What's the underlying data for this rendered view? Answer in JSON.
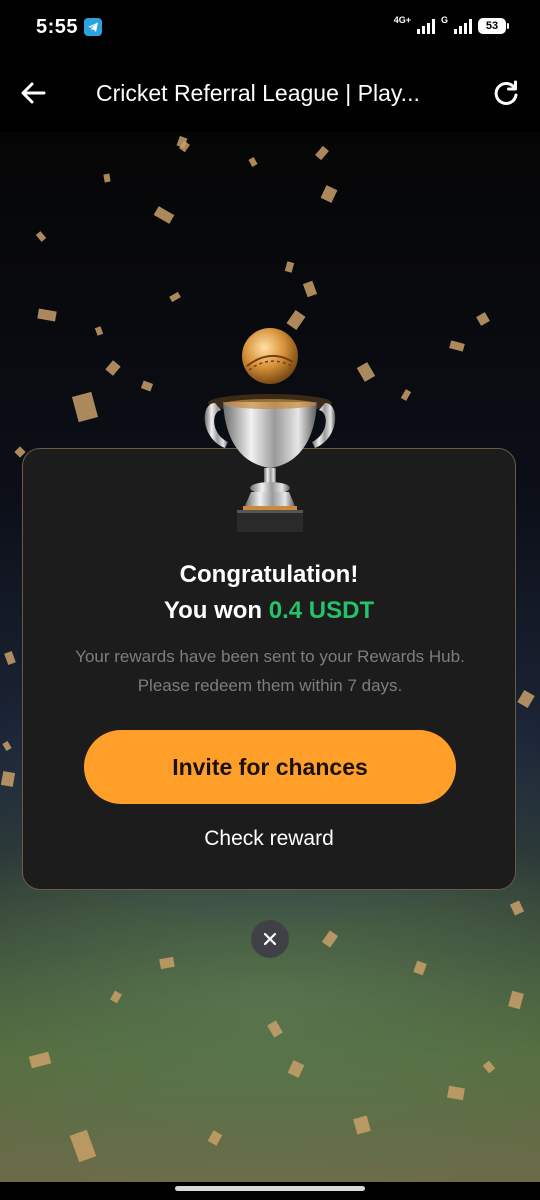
{
  "status_bar": {
    "time": "5:55",
    "network_primary": "4G+",
    "network_secondary": "G",
    "battery": "53"
  },
  "app_bar": {
    "title": "Cricket Referral League | Play..."
  },
  "dialog": {
    "heading": "Congratulation!",
    "won_prefix": "You won ",
    "won_amount": "0.4 USDT",
    "description": "Your rewards have been sent to your Rewards Hub. Please redeem them within 7 days.",
    "primary_button": "Invite for chances",
    "secondary_link": "Check reward"
  },
  "icons": {
    "back": "arrow-left-icon",
    "refresh": "refresh-icon",
    "close": "close-icon",
    "telegram": "telegram-icon",
    "trophy": "trophy-icon"
  },
  "colors": {
    "accent_orange": "#ff9f2a",
    "amount_green": "#26c26a",
    "card_bg": "#1c1c1c"
  }
}
